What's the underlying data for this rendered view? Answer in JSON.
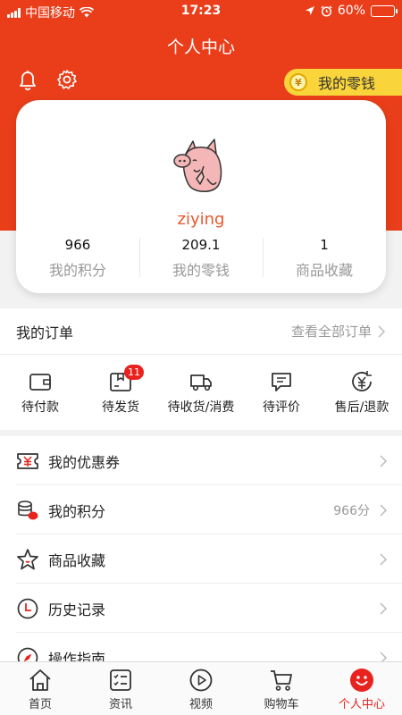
{
  "status_bar": {
    "carrier": "中国移动",
    "time": "17:23",
    "battery": "60%",
    "battery_level": 0.6
  },
  "header": {
    "title": "个人中心",
    "change_label": "我的零钱",
    "coin_symbol": "¥"
  },
  "profile": {
    "username": "ziying",
    "stats": [
      {
        "value": "966",
        "label": "我的积分"
      },
      {
        "value": "209.1",
        "label": "我的零钱"
      },
      {
        "value": "1",
        "label": "商品收藏"
      }
    ]
  },
  "orders": {
    "title": "我的订单",
    "view_all": "查看全部订单",
    "items": [
      {
        "label": "待付款",
        "icon": "wallet-icon"
      },
      {
        "label": "待发货",
        "icon": "package-icon",
        "badge": "11"
      },
      {
        "label": "待收货/消费",
        "icon": "truck-icon"
      },
      {
        "label": "待评价",
        "icon": "comment-icon"
      },
      {
        "label": "售后/退款",
        "icon": "refund-icon"
      }
    ]
  },
  "menu": [
    {
      "label": "我的优惠券",
      "icon": "coupon-icon",
      "meta": ""
    },
    {
      "label": "我的积分",
      "icon": "points-icon",
      "meta": "966分"
    },
    {
      "label": "商品收藏",
      "icon": "star-icon",
      "meta": ""
    },
    {
      "label": "历史记录",
      "icon": "clock-icon",
      "meta": ""
    },
    {
      "label": "操作指南",
      "icon": "compass-icon",
      "meta": ""
    }
  ],
  "tabs": [
    {
      "label": "首页",
      "icon": "home-icon"
    },
    {
      "label": "资讯",
      "icon": "news-icon"
    },
    {
      "label": "视频",
      "icon": "play-icon"
    },
    {
      "label": "购物车",
      "icon": "cart-icon"
    },
    {
      "label": "个人中心",
      "icon": "smiley-icon",
      "active": true
    }
  ],
  "colors": {
    "brand": "#ea3e1a",
    "accent_yellow": "#f9d43a",
    "badge": "#e8231f",
    "username": "#e8572b"
  }
}
